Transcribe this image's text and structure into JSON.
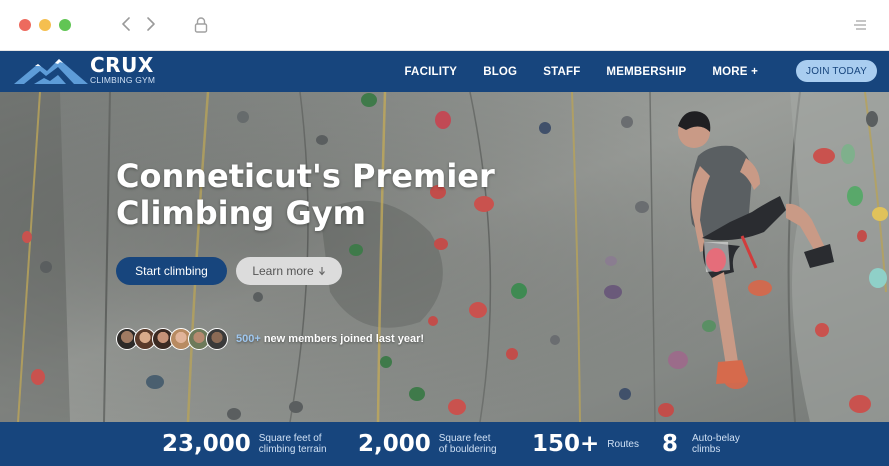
{
  "browser": {
    "back_icon": "chevron-left-icon",
    "forward_icon": "chevron-right-icon",
    "lock_icon": "lock-icon",
    "menu_icon": "sidebar-menu-icon"
  },
  "nav": {
    "logo_name": "CRUX",
    "logo_sub": "CLIMBING GYM",
    "links": [
      "FACILITY",
      "BLOG",
      "STAFF",
      "MEMBERSHIP",
      "MORE +"
    ],
    "cta": "JOIN TODAY",
    "background": "#17457d",
    "cta_color": "#a9cdf0"
  },
  "hero": {
    "title": "Conneticut's Premier Climbing Gym",
    "primary_button": "Start climbing",
    "secondary_button": "Learn more",
    "secondary_icon": "arrow-down-icon",
    "members_count": "500+",
    "members_text": " new members joined last year!"
  },
  "stats": [
    {
      "value": "23,000",
      "label_line1": "Square feet of",
      "label_line2": "climbing terrain"
    },
    {
      "value": "2,000",
      "label_line1": "Square feet",
      "label_line2": "of bouldering"
    },
    {
      "value": "150+",
      "label_line1": "Routes",
      "label_line2": ""
    },
    {
      "value": "8",
      "label_line1": "Auto-belay",
      "label_line2": "climbs"
    }
  ]
}
